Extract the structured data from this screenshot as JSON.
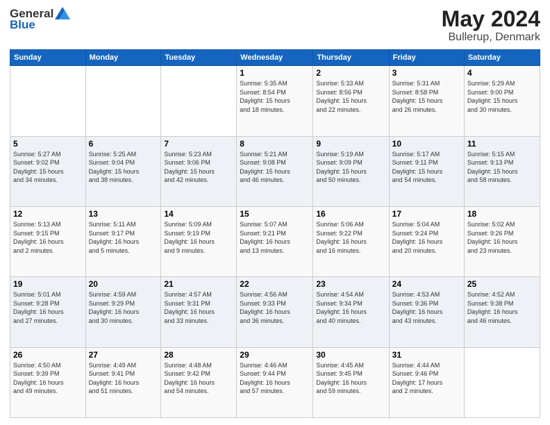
{
  "header": {
    "logo_general": "General",
    "logo_blue": "Blue",
    "month": "May 2024",
    "location": "Bullerup, Denmark"
  },
  "weekdays": [
    "Sunday",
    "Monday",
    "Tuesday",
    "Wednesday",
    "Thursday",
    "Friday",
    "Saturday"
  ],
  "weeks": [
    [
      {
        "day": "",
        "info": ""
      },
      {
        "day": "",
        "info": ""
      },
      {
        "day": "",
        "info": ""
      },
      {
        "day": "1",
        "info": "Sunrise: 5:35 AM\nSunset: 8:54 PM\nDaylight: 15 hours\nand 18 minutes."
      },
      {
        "day": "2",
        "info": "Sunrise: 5:33 AM\nSunset: 8:56 PM\nDaylight: 15 hours\nand 22 minutes."
      },
      {
        "day": "3",
        "info": "Sunrise: 5:31 AM\nSunset: 8:58 PM\nDaylight: 15 hours\nand 26 minutes."
      },
      {
        "day": "4",
        "info": "Sunrise: 5:29 AM\nSunset: 9:00 PM\nDaylight: 15 hours\nand 30 minutes."
      }
    ],
    [
      {
        "day": "5",
        "info": "Sunrise: 5:27 AM\nSunset: 9:02 PM\nDaylight: 15 hours\nand 34 minutes."
      },
      {
        "day": "6",
        "info": "Sunrise: 5:25 AM\nSunset: 9:04 PM\nDaylight: 15 hours\nand 38 minutes."
      },
      {
        "day": "7",
        "info": "Sunrise: 5:23 AM\nSunset: 9:06 PM\nDaylight: 15 hours\nand 42 minutes."
      },
      {
        "day": "8",
        "info": "Sunrise: 5:21 AM\nSunset: 9:08 PM\nDaylight: 15 hours\nand 46 minutes."
      },
      {
        "day": "9",
        "info": "Sunrise: 5:19 AM\nSunset: 9:09 PM\nDaylight: 15 hours\nand 50 minutes."
      },
      {
        "day": "10",
        "info": "Sunrise: 5:17 AM\nSunset: 9:11 PM\nDaylight: 15 hours\nand 54 minutes."
      },
      {
        "day": "11",
        "info": "Sunrise: 5:15 AM\nSunset: 9:13 PM\nDaylight: 15 hours\nand 58 minutes."
      }
    ],
    [
      {
        "day": "12",
        "info": "Sunrise: 5:13 AM\nSunset: 9:15 PM\nDaylight: 16 hours\nand 2 minutes."
      },
      {
        "day": "13",
        "info": "Sunrise: 5:11 AM\nSunset: 9:17 PM\nDaylight: 16 hours\nand 5 minutes."
      },
      {
        "day": "14",
        "info": "Sunrise: 5:09 AM\nSunset: 9:19 PM\nDaylight: 16 hours\nand 9 minutes."
      },
      {
        "day": "15",
        "info": "Sunrise: 5:07 AM\nSunset: 9:21 PM\nDaylight: 16 hours\nand 13 minutes."
      },
      {
        "day": "16",
        "info": "Sunrise: 5:06 AM\nSunset: 9:22 PM\nDaylight: 16 hours\nand 16 minutes."
      },
      {
        "day": "17",
        "info": "Sunrise: 5:04 AM\nSunset: 9:24 PM\nDaylight: 16 hours\nand 20 minutes."
      },
      {
        "day": "18",
        "info": "Sunrise: 5:02 AM\nSunset: 9:26 PM\nDaylight: 16 hours\nand 23 minutes."
      }
    ],
    [
      {
        "day": "19",
        "info": "Sunrise: 5:01 AM\nSunset: 9:28 PM\nDaylight: 16 hours\nand 27 minutes."
      },
      {
        "day": "20",
        "info": "Sunrise: 4:59 AM\nSunset: 9:29 PM\nDaylight: 16 hours\nand 30 minutes."
      },
      {
        "day": "21",
        "info": "Sunrise: 4:57 AM\nSunset: 9:31 PM\nDaylight: 16 hours\nand 33 minutes."
      },
      {
        "day": "22",
        "info": "Sunrise: 4:56 AM\nSunset: 9:33 PM\nDaylight: 16 hours\nand 36 minutes."
      },
      {
        "day": "23",
        "info": "Sunrise: 4:54 AM\nSunset: 9:34 PM\nDaylight: 16 hours\nand 40 minutes."
      },
      {
        "day": "24",
        "info": "Sunrise: 4:53 AM\nSunset: 9:36 PM\nDaylight: 16 hours\nand 43 minutes."
      },
      {
        "day": "25",
        "info": "Sunrise: 4:52 AM\nSunset: 9:38 PM\nDaylight: 16 hours\nand 46 minutes."
      }
    ],
    [
      {
        "day": "26",
        "info": "Sunrise: 4:50 AM\nSunset: 9:39 PM\nDaylight: 16 hours\nand 49 minutes."
      },
      {
        "day": "27",
        "info": "Sunrise: 4:49 AM\nSunset: 9:41 PM\nDaylight: 16 hours\nand 51 minutes."
      },
      {
        "day": "28",
        "info": "Sunrise: 4:48 AM\nSunset: 9:42 PM\nDaylight: 16 hours\nand 54 minutes."
      },
      {
        "day": "29",
        "info": "Sunrise: 4:46 AM\nSunset: 9:44 PM\nDaylight: 16 hours\nand 57 minutes."
      },
      {
        "day": "30",
        "info": "Sunrise: 4:45 AM\nSunset: 9:45 PM\nDaylight: 16 hours\nand 59 minutes."
      },
      {
        "day": "31",
        "info": "Sunrise: 4:44 AM\nSunset: 9:46 PM\nDaylight: 17 hours\nand 2 minutes."
      },
      {
        "day": "",
        "info": ""
      }
    ]
  ]
}
